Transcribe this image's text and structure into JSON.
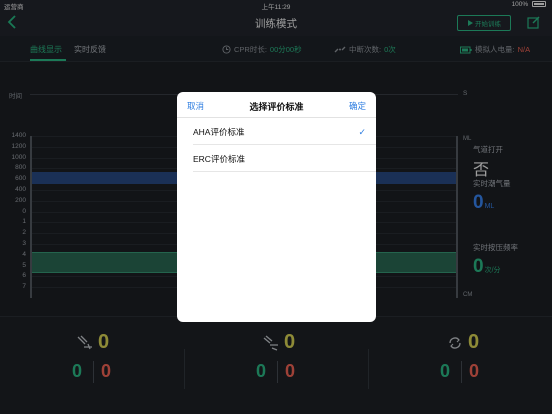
{
  "status_bar": {
    "carrier": "运营商",
    "time": "上午11:29",
    "battery": "100%"
  },
  "nav": {
    "title": "训练模式",
    "start_button": "开始训练"
  },
  "tabs": [
    {
      "label": "曲线显示",
      "active": true
    },
    {
      "label": "实时反馈",
      "active": false
    }
  ],
  "metrics": {
    "cpr_time_label": "CPR时长:",
    "cpr_time_value": "00分00秒",
    "interrupt_label": "中断次数:",
    "interrupt_value": "0次",
    "battery_label": "模拟人电量:",
    "battery_value": "N/A"
  },
  "chart": {
    "time_label": "时间",
    "time_unit": "S",
    "y_ticks": [
      "1400",
      "1200",
      "1000",
      "800",
      "600",
      "400",
      "200",
      "0",
      "1",
      "2",
      "3",
      "4",
      "5",
      "6",
      "7"
    ],
    "unit_ml": "ML",
    "unit_cm": "CM"
  },
  "side_panel": {
    "airway_label": "气道打开",
    "airway_value": "否",
    "tidal_label": "实时潮气量",
    "tidal_value": "0",
    "tidal_unit": "ML",
    "rate_label": "实时按压频率",
    "rate_value": "0",
    "rate_unit": "次/分"
  },
  "bottom_stats": [
    {
      "main": "0",
      "good": "0",
      "bad": "0"
    },
    {
      "main": "0",
      "good": "0",
      "bad": "0"
    },
    {
      "main": "0",
      "good": "0",
      "bad": "0"
    }
  ],
  "modal": {
    "cancel": "取消",
    "title": "选择评价标准",
    "confirm": "确定",
    "options": [
      {
        "label": "AHA评价标准",
        "selected": true
      },
      {
        "label": "ERC评价标准",
        "selected": false
      }
    ]
  },
  "colors": {
    "accent": "#2ec48d",
    "warn": "#ff6a5a",
    "highlight": "#e6e05a",
    "link": "#2d7de0"
  }
}
